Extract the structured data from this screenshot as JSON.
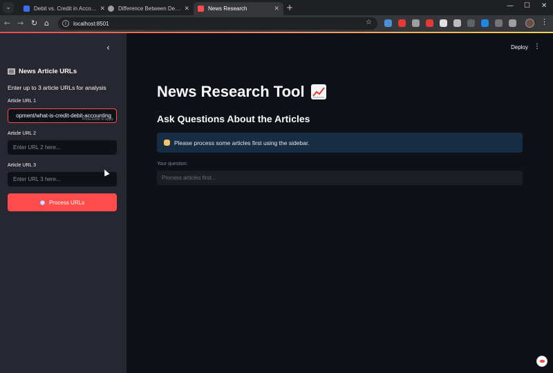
{
  "browser": {
    "tabs": [
      {
        "title": "Debit vs. Credit in Accounting:",
        "active": false,
        "fav_color": "#3c6df0"
      },
      {
        "title": "Difference Between Debit and",
        "active": false,
        "fav_color": "#9e9e9e"
      },
      {
        "title": "News Research",
        "active": true,
        "fav_color": "#ff4b4b"
      }
    ],
    "url": "localhost:8501",
    "icons": {
      "new_tab": "+",
      "minimize": "—",
      "maximize": "☐",
      "close": "✕",
      "back": "←",
      "forward": "→",
      "reload": "↻",
      "home": "⌂",
      "star": "☆",
      "menu": "⋮",
      "tab_close": "✕",
      "tab_search": "⌄"
    },
    "extension_colors": [
      "#4a90d9",
      "#e53935",
      "#9e9e9e",
      "#e53935",
      "#e0e0e0",
      "#bdbdbd",
      "#5f6368",
      "#1e88e5",
      "#757575",
      "#9e9e9e"
    ]
  },
  "sidebar": {
    "collapse_icon": "‹",
    "title": "News Article URLs",
    "description": "Enter up to 3 article URLs for analysis",
    "fields": [
      {
        "label": "Article URL 1",
        "value": "opment/what-is-credit-debit-accounting",
        "placeholder": "",
        "hint": "Press Enter to apply"
      },
      {
        "label": "Article URL 2",
        "value": "",
        "placeholder": "Enter URL 2 here..."
      },
      {
        "label": "Article URL 3",
        "value": "",
        "placeholder": "Enter URL 3 here..."
      }
    ],
    "process_button": "Process URLs"
  },
  "main": {
    "deploy_label": "Deploy",
    "menu_icon": "⋮",
    "title": "News Research Tool",
    "subheading": "Ask Questions About the Articles",
    "info_message": "Please process some articles first using the sidebar.",
    "question_label": "Your question:",
    "question_placeholder": "Process articles first..."
  }
}
